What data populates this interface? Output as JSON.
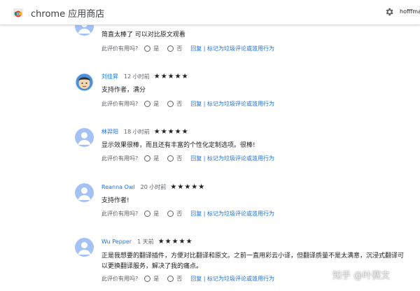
{
  "header": {
    "store_title": "chrome 应用商店",
    "user_name": "hofffmar"
  },
  "reviews": [
    {
      "author": "",
      "time": "",
      "stars": "",
      "text": "简直太棒了 可以对比原文观看",
      "helpful_label": "此评价有用吗?",
      "yes": "是",
      "no": "否",
      "actions": "回复 | 标记为垃圾评论或滥用行为",
      "avatar": "person-icon"
    },
    {
      "author": "刘佳昇",
      "time": "12 小时前",
      "stars": "★★★★★",
      "text": "支持作者，满分",
      "helpful_label": "此评价有用吗?",
      "yes": "是",
      "no": "否",
      "actions": "回复 | 标记为垃圾评论或滥用行为",
      "avatar": "cartoon-avatar"
    },
    {
      "author": "林羿阳",
      "time": "18 小时前",
      "stars": "★★★★★",
      "text": "显示效果很棒，而且还有丰富的个性化定制选项。很棒!",
      "helpful_label": "此评价有用吗?",
      "yes": "是",
      "no": "否",
      "actions": "回复 | 标记为垃圾评论或滥用行为",
      "avatar": "person-icon"
    },
    {
      "author": "Reanna Owl",
      "time": "20 小时前",
      "stars": "★★★★★",
      "text": "支持作者!",
      "helpful_label": "此评价有用吗?",
      "yes": "是",
      "no": "否",
      "actions": "回复 | 标记为垃圾评论或滥用行为",
      "avatar": "person-icon"
    },
    {
      "author": "Wu Pepper",
      "time": "1 天前",
      "stars": "★★★★★",
      "text": "正是我想要的翻译插件，方便对比翻译和原文。之前一直用彩云小译，但翻译质量不是太满意，沉浸式翻译可以更换翻译服务，解决了我的痛点。",
      "helpful_label": "此评价有用吗?",
      "yes": "是",
      "no": "否",
      "actions": "回复 | 标记为垃圾评论或滥用行为",
      "avatar": "person-icon"
    }
  ],
  "watermark": "知乎 @叶赛文",
  "colors": {
    "link": "#1a73e8",
    "avatar_bg": "#a5c2f7",
    "avatar_fg": "#ffffff"
  }
}
